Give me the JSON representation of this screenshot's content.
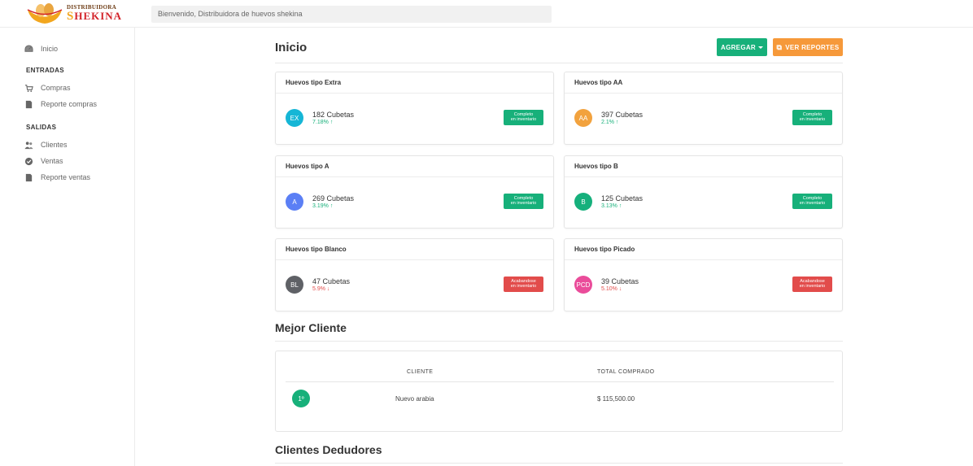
{
  "brand": {
    "small": "DISTRIBUIDORA",
    "big_first": "S",
    "big_rest": "HEKINA",
    "colors": {
      "brown": "#6d3b14",
      "red": "#d3232a",
      "gold": "#f2a61e"
    }
  },
  "header": {
    "welcome": "Bienvenido, Distribuidora de huevos shekina"
  },
  "sidebar": {
    "inicio": "Inicio",
    "entradas_title": "ENTRADAS",
    "compras": "Compras",
    "reporte_compras": "Reporte compras",
    "salidas_title": "SALIDAS",
    "clientes": "Clientes",
    "ventas": "Ventas",
    "reporte_ventas": "Reporte ventas"
  },
  "main": {
    "title": "Inicio",
    "agregar_label": "AGREGAR",
    "reportes_label": "VER REPORTES",
    "colors": {
      "green": "#17b07a",
      "orange": "#f6993a",
      "red": "#e24c4b"
    }
  },
  "cards": [
    {
      "title": "Huevos tipo Extra",
      "abbr": "EX",
      "color": "#16b6d6",
      "qty": "182 Cubetas",
      "pct": "7.18%",
      "trend": "up",
      "status_l1": "Completo",
      "status_l2": "en inventario",
      "status": "ok"
    },
    {
      "title": "Huevos tipo AA",
      "abbr": "AA",
      "color": "#f2a23e",
      "qty": "397 Cubetas",
      "pct": "2.1%",
      "trend": "up",
      "status_l1": "Completo",
      "status_l2": "en inventario",
      "status": "ok"
    },
    {
      "title": "Huevos tipo A",
      "abbr": "A",
      "color": "#5b7ff5",
      "qty": "269 Cubetas",
      "pct": "3.19%",
      "trend": "up",
      "status_l1": "Completo",
      "status_l2": "en inventario",
      "status": "ok"
    },
    {
      "title": "Huevos tipo B",
      "abbr": "B",
      "color": "#16b07c",
      "qty": "125 Cubetas",
      "pct": "3.13%",
      "trend": "up",
      "status_l1": "Completo",
      "status_l2": "en inventario",
      "status": "ok"
    },
    {
      "title": "Huevos tipo Blanco",
      "abbr": "BL",
      "color": "#5f6166",
      "qty": "47 Cubetas",
      "pct": "5.9%",
      "trend": "down",
      "status_l1": "Acabandose",
      "status_l2": "en inventario",
      "status": "low"
    },
    {
      "title": "Huevos tipo Picado",
      "abbr": "PCD",
      "color": "#ea4c9a",
      "qty": "39 Cubetas",
      "pct": "5.10%",
      "trend": "down",
      "status_l1": "Acabandose",
      "status_l2": "en inventario",
      "status": "low"
    }
  ],
  "best_client": {
    "title": "Mejor Cliente",
    "col_client": "CLIENTE",
    "col_total": "TOTAL COMPRADO",
    "rank": "1º",
    "client": "Nuevo arabia",
    "total": "$ 115,500.00"
  },
  "debtors": {
    "title": "Clientes Dedudores"
  }
}
